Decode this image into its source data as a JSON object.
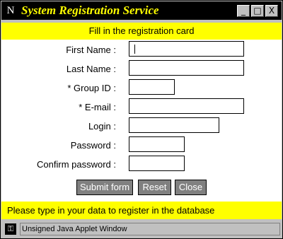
{
  "titlebar": {
    "app_icon": "N",
    "title": "System Registration Service",
    "buttons": {
      "minimize": "_",
      "maximize": "□",
      "close": "X"
    }
  },
  "header_banner": "Fill in the registration card",
  "form": {
    "fields": [
      {
        "label": "First Name :",
        "value": ""
      },
      {
        "label": "Last Name :",
        "value": ""
      },
      {
        "label": "* Group ID :",
        "value": ""
      },
      {
        "label": "* E-mail :",
        "value": ""
      },
      {
        "label": "Login :",
        "value": ""
      },
      {
        "label": "Password :",
        "value": ""
      },
      {
        "label": "Confirm password :",
        "value": ""
      }
    ],
    "buttons": {
      "submit": "Submit form",
      "reset": "Reset",
      "close": "Close"
    }
  },
  "footer_banner": "Please type in your data to register in the database",
  "statusbar": {
    "text": "Unsigned Java Applet Window",
    "icon": "unlocked-key-icon"
  },
  "colors": {
    "accent": "#ffff00",
    "title_bg": "#000000",
    "panel": "#c0c0c0",
    "button": "#808080"
  }
}
